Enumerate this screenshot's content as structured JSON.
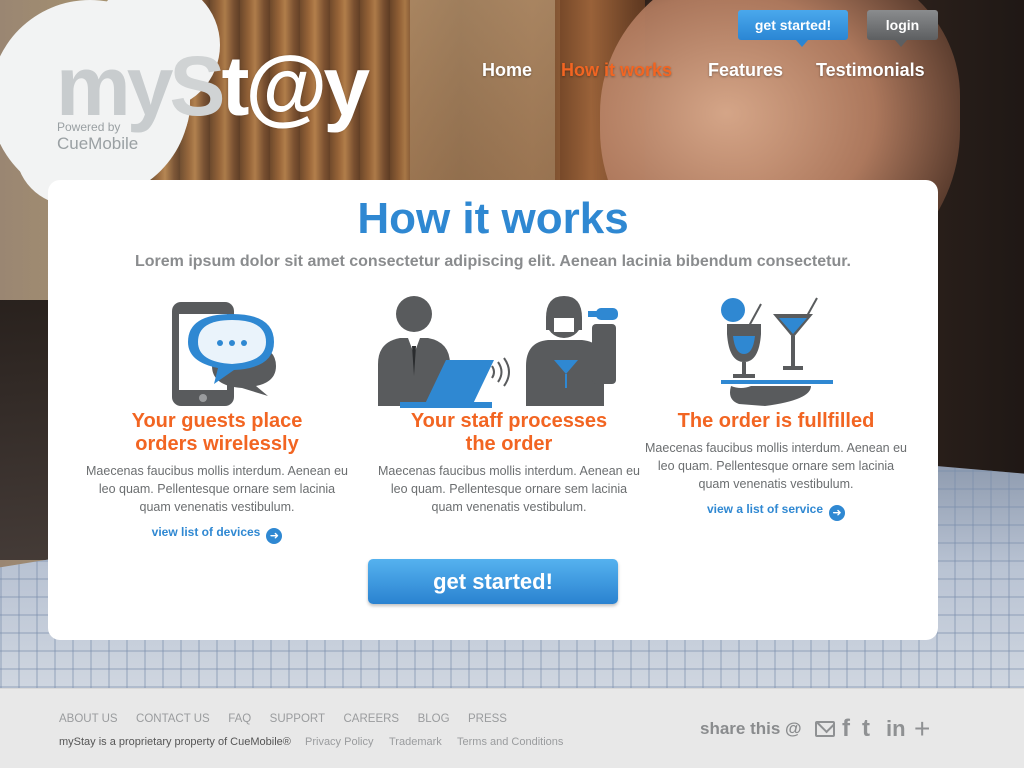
{
  "brand": {
    "logo_my": "my",
    "logo_s": "S",
    "logo_tay": "t@y",
    "powered_by": "Powered by",
    "company": "CueMobile"
  },
  "top_buttons": {
    "get_started": "get started!",
    "login": "login"
  },
  "nav": {
    "items": [
      {
        "label": "Home",
        "active": false
      },
      {
        "label": "How it works",
        "active": true
      },
      {
        "label": "Features",
        "active": false
      },
      {
        "label": "Testimonials",
        "active": false
      }
    ]
  },
  "main": {
    "title": "How it works",
    "subtitle": "Lorem ipsum dolor sit amet consectetur adipiscing elit. Aenean lacinia bibendum consectetur.",
    "columns": [
      {
        "icon": "phone-chat-icon",
        "heading_line1": "Your guests place",
        "heading_line2": "orders wirelessly",
        "body": "Maecenas faucibus mollis interdum. Aenean eu leo quam. Pellentesque ornare sem lacinia quam venenatis vestibulum.",
        "link": "view list of devices"
      },
      {
        "icon": "staff-laptop-icon",
        "heading_line1": "Your staff processes",
        "heading_line2": "the order",
        "body": "Maecenas faucibus mollis interdum. Aenean eu leo quam. Pellentesque ornare sem lacinia quam venenatis vestibulum.",
        "link": ""
      },
      {
        "icon": "cocktail-tray-icon",
        "heading_line1": "The order is fullfilled",
        "heading_line2": "",
        "body": "Maecenas faucibus mollis interdum. Aenean eu leo quam. Pellentesque ornare sem lacinia quam venenatis vestibulum.",
        "link": "view a list of service"
      }
    ],
    "cta": "get started!"
  },
  "footer": {
    "links": [
      "ABOUT US",
      "CONTACT US",
      "FAQ",
      "SUPPORT",
      "CAREERS",
      "BLOG",
      "PRESS"
    ],
    "copyright": "myStay is a proprietary property of CueMobile®",
    "sublinks": [
      "Privacy Policy",
      "Trademark",
      "Terms and Conditions"
    ],
    "share_label": "share this @",
    "social": {
      "facebook": "f",
      "twitter": "t",
      "linkedin": "in",
      "plus": "+"
    }
  },
  "colors": {
    "accent_blue": "#2f88d2",
    "accent_orange": "#f26522",
    "card_bg": "#ffffff",
    "footer_bg": "#e8e8e8"
  }
}
